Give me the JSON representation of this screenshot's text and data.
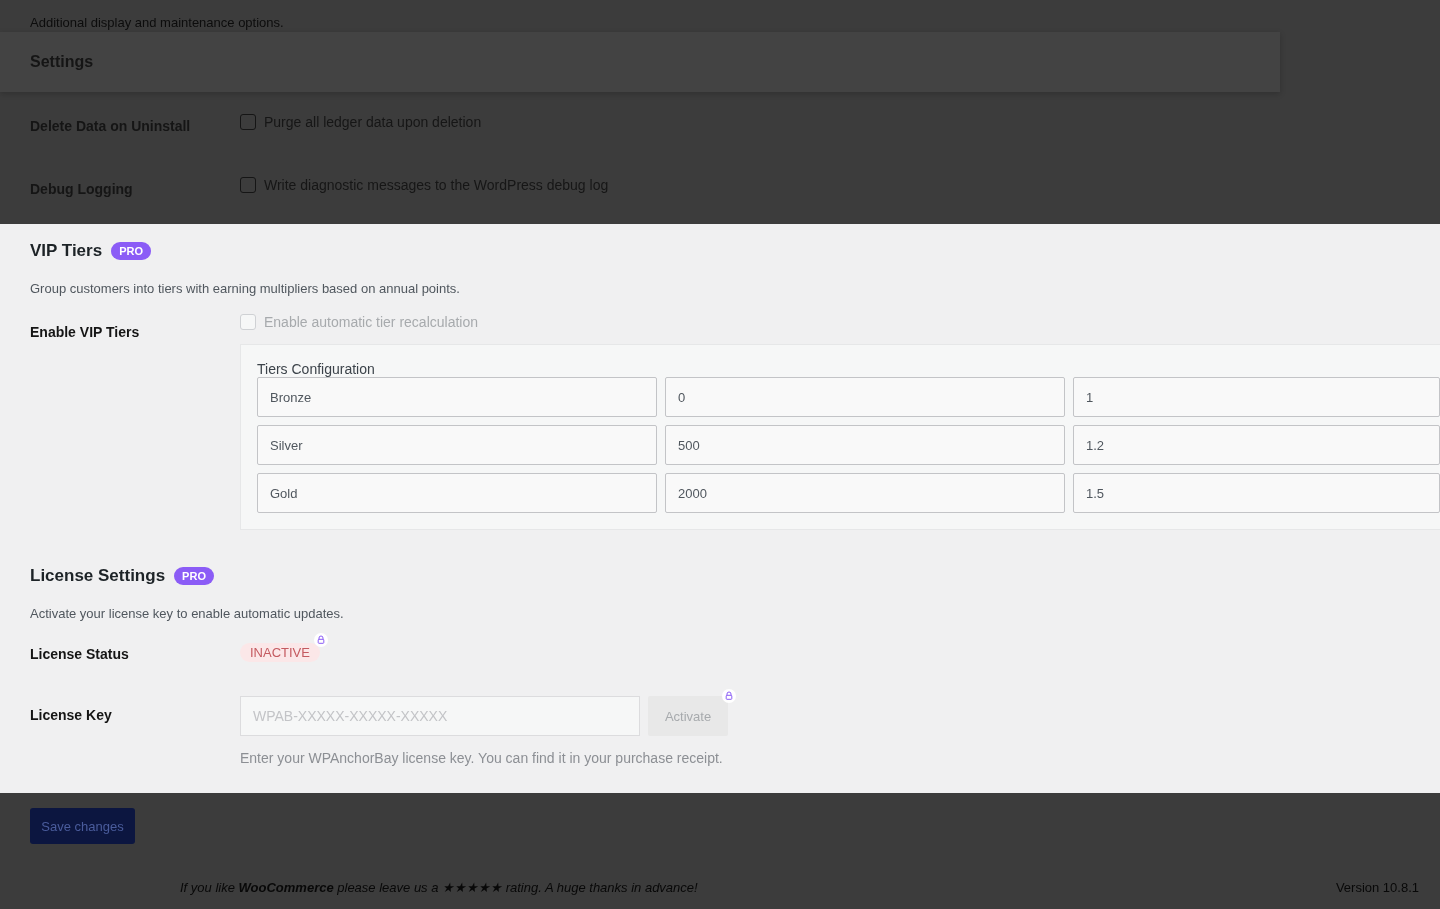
{
  "intro_text": "Additional display and maintenance options.",
  "sticky_header": {
    "title": "Settings"
  },
  "general_rows": [
    {
      "label": "Delete Data on Uninstall",
      "checkbox_label": "Purge all ledger data upon deletion",
      "checked": false,
      "disabled": false
    },
    {
      "label": "Debug Logging",
      "checkbox_label": "Write diagnostic messages to the WordPress debug log",
      "checked": false,
      "disabled": false
    }
  ],
  "vip_section": {
    "title": "VIP Tiers",
    "badge": "PRO",
    "description": "Group customers into tiers with earning multipliers based on annual points.",
    "enable_row": {
      "label": "Enable VIP Tiers",
      "checkbox_label": "Enable automatic tier recalculation",
      "checked": false,
      "disabled": true
    },
    "tiers": {
      "title": "Tiers Configuration",
      "rows": [
        {
          "values": [
            "Bronze",
            "0",
            "1"
          ]
        },
        {
          "values": [
            "Silver",
            "500",
            "1.2"
          ]
        },
        {
          "values": [
            "Gold",
            "2000",
            "1.5"
          ]
        }
      ]
    }
  },
  "license_section": {
    "title": "License Settings",
    "badge": "PRO",
    "description": "Activate your license key to enable automatic updates.",
    "status": {
      "label": "License Status",
      "value": "INACTIVE",
      "locked": true
    },
    "key": {
      "label": "License Key",
      "placeholder": "WPAB-XXXXX-XXXXX-XXXXX",
      "button": "Activate",
      "locked": true,
      "help": "Enter your WPAnchorBay license key. You can find it in your purchase receipt."
    }
  },
  "footer": {
    "save_button": "Save changes",
    "rating_text": "If you like **WooCommerce** please leave us a ★★★★★ rating. A huge thanks in advance!",
    "version": "Version 10.8.1"
  }
}
